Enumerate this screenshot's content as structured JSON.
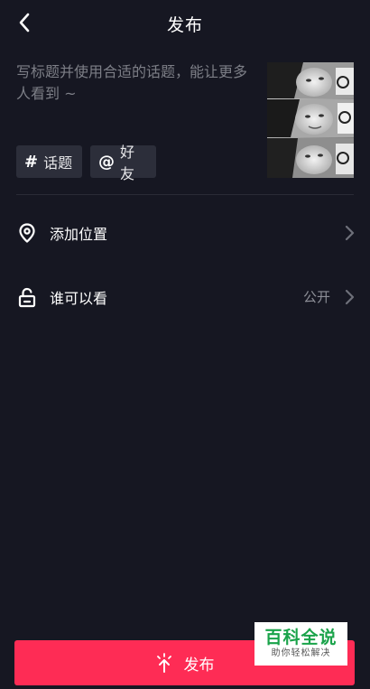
{
  "header": {
    "title": "发布",
    "back_icon": "chevron-left-icon"
  },
  "caption": {
    "placeholder": "写标题并使用合适的话题，能让更多人看到 ~"
  },
  "tags": [
    {
      "glyph": "#",
      "label": "话题",
      "icon": "hashtag-icon"
    },
    {
      "glyph": "@",
      "label": "好友",
      "icon": "at-sign-icon"
    }
  ],
  "settings": {
    "location": {
      "label": "添加位置",
      "icon": "location-pin-icon"
    },
    "visibility": {
      "label": "谁可以看",
      "value": "公开",
      "icon": "unlock-icon"
    }
  },
  "publish": {
    "label": "发布",
    "color": "#fe2c55",
    "icon": "sparkle-arrow-icon"
  },
  "watermark": {
    "title": "百科全说",
    "subtitle": "助你轻松解决"
  },
  "colors": {
    "background": "#161722",
    "tag_background": "#2c2e3a"
  }
}
